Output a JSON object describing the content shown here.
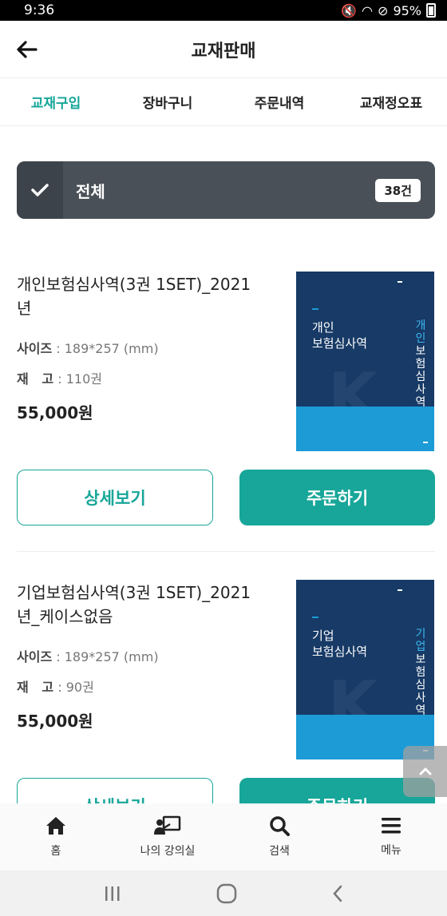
{
  "status_bar": {
    "time": "9:36",
    "battery": "95%"
  },
  "header": {
    "title": "교재판매"
  },
  "tabs": [
    {
      "label": "교재구입",
      "active": true
    },
    {
      "label": "장바구니",
      "active": false
    },
    {
      "label": "주문내역",
      "active": false
    },
    {
      "label": "교재정오표",
      "active": false
    }
  ],
  "filter": {
    "label": "전체",
    "count": "38건"
  },
  "products": [
    {
      "name_line1": "개인보험심사역(3권 1SET)_2021",
      "name_line2": "년",
      "size_label": "사이즈",
      "size_value": ": 189*257 (mm)",
      "stock_label": "재   고",
      "stock_value": ": 110권",
      "price": "55,000원",
      "cover": {
        "title1": "개인",
        "title2": "보험심사역",
        "vertical1": "개인",
        "vertical2": "보험심사역"
      },
      "detail_label": "상세보기",
      "order_label": "주문하기"
    },
    {
      "name_line1": "기업보험심사역(3권 1SET)_2021",
      "name_line2": "년_케이스없음",
      "size_label": "사이즈",
      "size_value": ": 189*257 (mm)",
      "stock_label": "재   고",
      "stock_value": ": 90권",
      "price": "55,000원",
      "cover": {
        "title1": "기업",
        "title2": "보험심사역",
        "vertical1": "기업",
        "vertical2": "보험심사역"
      },
      "detail_label": "상세보기",
      "order_label": "주문하기"
    }
  ],
  "bottom_nav": [
    {
      "label": "홈",
      "icon": "home-icon"
    },
    {
      "label": "나의 강의실",
      "icon": "classroom-icon"
    },
    {
      "label": "검색",
      "icon": "search-icon"
    },
    {
      "label": "메뉴",
      "icon": "menu-icon"
    }
  ],
  "colors": {
    "accent": "#17a699",
    "filter_bg": "#4a5058",
    "cover_bg": "#173a66",
    "cover_band": "#1c9bd6"
  }
}
